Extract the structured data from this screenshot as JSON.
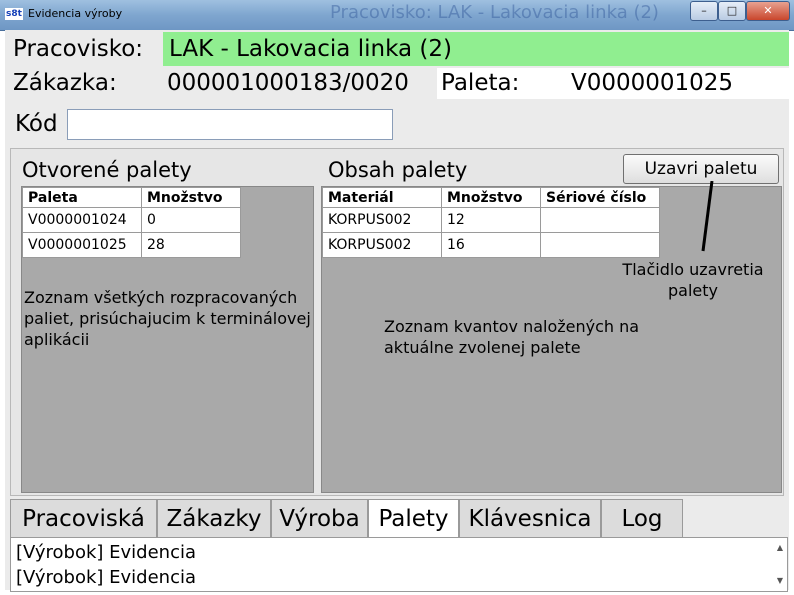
{
  "window": {
    "icon_text": "s8t",
    "title": "Evidencia výroby",
    "background_title": "Pracovisko: LAK - Lakovacia linka (2)",
    "minimize_glyph": "–",
    "maximize_glyph": "□",
    "close_glyph": "✕"
  },
  "header": {
    "workplace_label": "Pracovisko:",
    "workplace_value": "LAK - Lakovacia linka (2)",
    "workplace_highlight": "#90ee90",
    "order_label": "Zákazka:",
    "order_value": "000001000183/0020",
    "pallet_label": "Paleta:",
    "pallet_value": "V0000001025",
    "code_label": "Kód",
    "code_value": ""
  },
  "open_pallets": {
    "title": "Otvorené palety",
    "columns": [
      "Paleta",
      "Množstvo"
    ],
    "rows": [
      [
        "V0000001024",
        "0"
      ],
      [
        "V0000001025",
        "28"
      ]
    ],
    "note": "Zoznam všetkých rozpracovaných paliet, prisúchajucim k terminálovej aplikácii"
  },
  "pallet_content": {
    "title": "Obsah palety",
    "close_button": "Uzavri paletu",
    "columns": [
      "Materiál",
      "Množstvo",
      "Sériové číslo"
    ],
    "rows": [
      [
        "KORPUS002",
        "12",
        ""
      ],
      [
        "KORPUS002",
        "16",
        ""
      ]
    ],
    "note": "Zoznam kvantov naložených na aktuálne zvolenej palete",
    "callout": "Tlačidlo uzavretia palety"
  },
  "tabs": [
    {
      "label": "Pracoviská",
      "active": false
    },
    {
      "label": "Zákazky",
      "active": false
    },
    {
      "label": "Výroba",
      "active": false
    },
    {
      "label": "Palety",
      "active": true
    },
    {
      "label": "Klávesnica",
      "active": false
    },
    {
      "label": "Log",
      "active": false
    }
  ],
  "log": {
    "lines": [
      "[Výrobok] Evidencia",
      "[Výrobok] Evidencia"
    ],
    "scroll_up_icon": "▲",
    "scroll_down_icon": "▼"
  }
}
